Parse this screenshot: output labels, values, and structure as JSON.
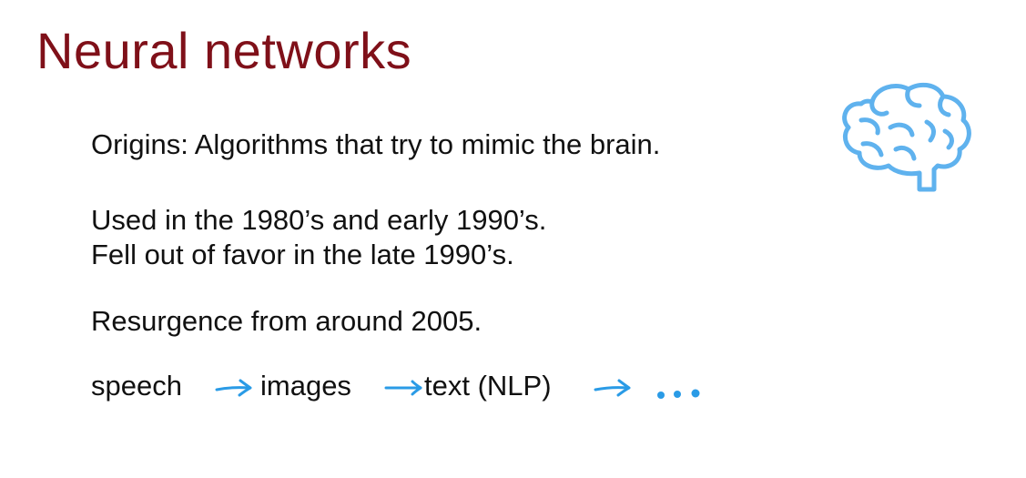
{
  "slide": {
    "title": "Neural networks",
    "line1": "Origins: Algorithms that try to mimic the brain.",
    "line2": "Used in the 1980’s and early 1990’s.",
    "line3": "Fell out of favor in the late 1990’s.",
    "line4": "Resurgence from around 2005.",
    "flow": {
      "items": [
        "speech",
        "images",
        "text (NLP)"
      ],
      "ellipsis_icon": "dots-icon",
      "arrow_icon": "arrow-right-icon"
    },
    "brain_icon": "brain-icon",
    "colors": {
      "title": "#7f1019",
      "text": "#111111",
      "ink": "#2a9be6",
      "brain": "#5fb2ee"
    }
  }
}
